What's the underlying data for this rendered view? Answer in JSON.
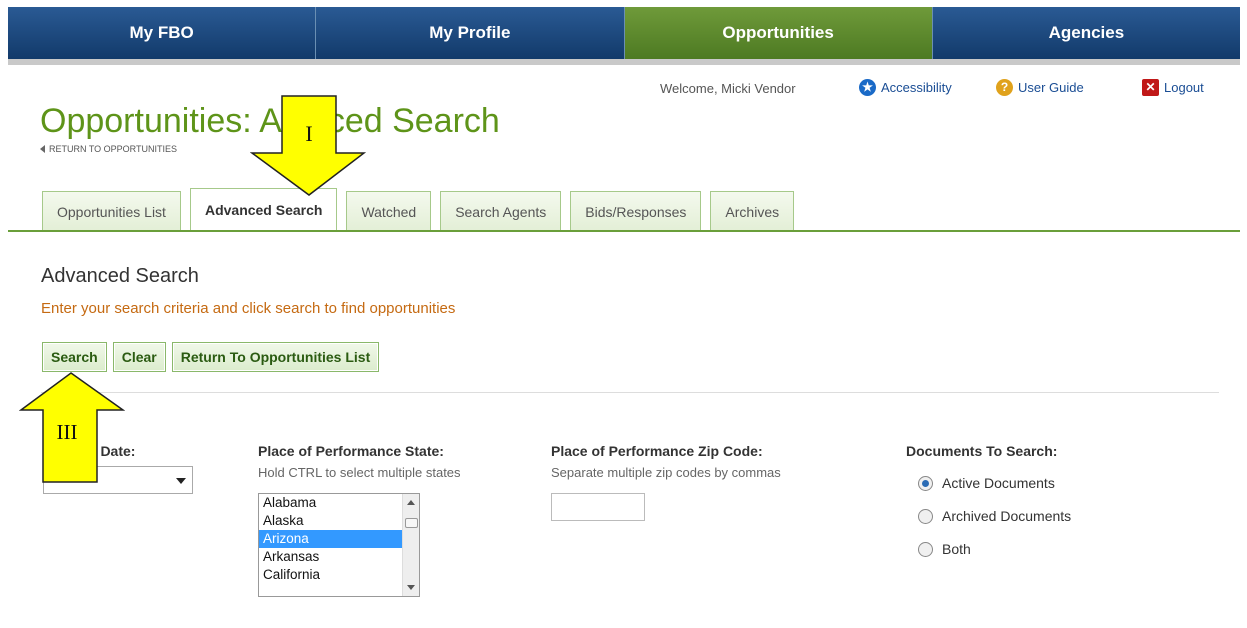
{
  "nav": {
    "tabs": [
      {
        "label": "My FBO"
      },
      {
        "label": "My Profile"
      },
      {
        "label": "Opportunities",
        "active": true
      },
      {
        "label": "Agencies"
      }
    ]
  },
  "header": {
    "welcome": "Welcome, Micki Vendor",
    "accessibility": "Accessibility",
    "user_guide": "User Guide",
    "logout": "Logout",
    "title": "Opportunities: Advanced Search",
    "title_left": "Opportunities: A",
    "title_right": "nced Search",
    "return_link": "RETURN TO OPPORTUNITIES"
  },
  "tabs": [
    {
      "label": "Opportunities List"
    },
    {
      "label": "Advanced Search",
      "active": true
    },
    {
      "label": "Watched"
    },
    {
      "label": "Search Agents"
    },
    {
      "label": "Bids/Responses"
    },
    {
      "label": "Archives"
    }
  ],
  "section": {
    "title": "Advanced Search",
    "subtitle": "Enter your search criteria and click search to find opportunities"
  },
  "buttons": {
    "search": "Search",
    "clear": "Clear",
    "return": "Return To Opportunities List"
  },
  "fields": {
    "date_label": "d Date:",
    "state_label": "Place of Performance State:",
    "state_hint": "Hold CTRL to select multiple states",
    "states": [
      "Alabama",
      "Alaska",
      "Arizona",
      "Arkansas",
      "California"
    ],
    "selected_state": "Arizona",
    "zip_label": "Place of Performance Zip Code:",
    "zip_hint": "Separate multiple zip codes by commas",
    "zip_value": "",
    "docs_label": "Documents To Search:",
    "docs_options": [
      "Active Documents",
      "Archived Documents",
      "Both"
    ],
    "docs_selected": "Active Documents"
  },
  "annotations": {
    "arrow_1": "I",
    "arrow_3": "III"
  },
  "colors": {
    "nav_blue": "#123a6a",
    "nav_green": "#4d7a22",
    "title_green": "#5e9419",
    "subtitle_orange": "#c56a12",
    "annotation_yellow": "#ffff00"
  }
}
